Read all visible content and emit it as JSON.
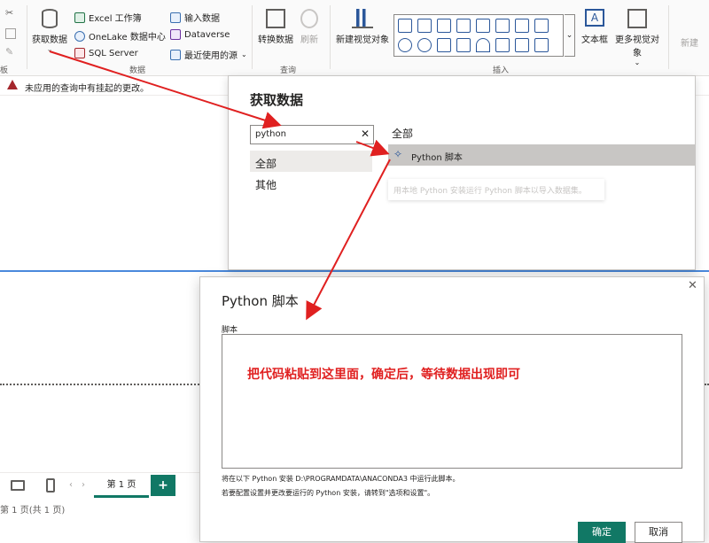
{
  "ribbon": {
    "get_data": "获取数据",
    "excel": "Excel 工作簿",
    "onelake": "OneLake 数据中心",
    "sql": "SQL Server",
    "enter_data": "输入数据",
    "dataverse": "Dataverse",
    "recent": "最近使用的源",
    "group_data": "数据",
    "transform": "转换数据",
    "refresh": "刷新",
    "group_query": "查询",
    "new_visual": "新建视觉对象",
    "textbox": "文本框",
    "more_visuals": "更多视觉对象",
    "group_insert": "插入",
    "new_measure": "新建",
    "group_left": "板"
  },
  "warning": {
    "text": "未应用的查询中有挂起的更改。"
  },
  "get_data_dialog": {
    "title": "获取数据",
    "search_value": "python",
    "categories": [
      "全部",
      "其他"
    ],
    "right_header": "全部",
    "item": "Python 脚本",
    "tooltip": "用本地 Python 安装运行 Python 脚本以导入数据集。"
  },
  "python_dialog": {
    "title": "Python 脚本",
    "script_label": "脚本",
    "annotation": "把代码粘贴到这里面，确定后，等待数据出现即可",
    "note1": "将在以下 Python 安装 D:\\PROGRAMDATA\\ANACONDA3 中运行此脚本。",
    "note2": "若要配置设置并更改要运行的 Python 安装，请转到\"选项和设置\"。",
    "ok": "确定",
    "cancel": "取消"
  },
  "pages": {
    "tab": "第 1 页",
    "status": "第 1 页(共 1 页)",
    "add": "+"
  },
  "colors": {
    "accent": "#117865",
    "annotation_red": "#e02020",
    "selected": "#c8c6c4"
  }
}
